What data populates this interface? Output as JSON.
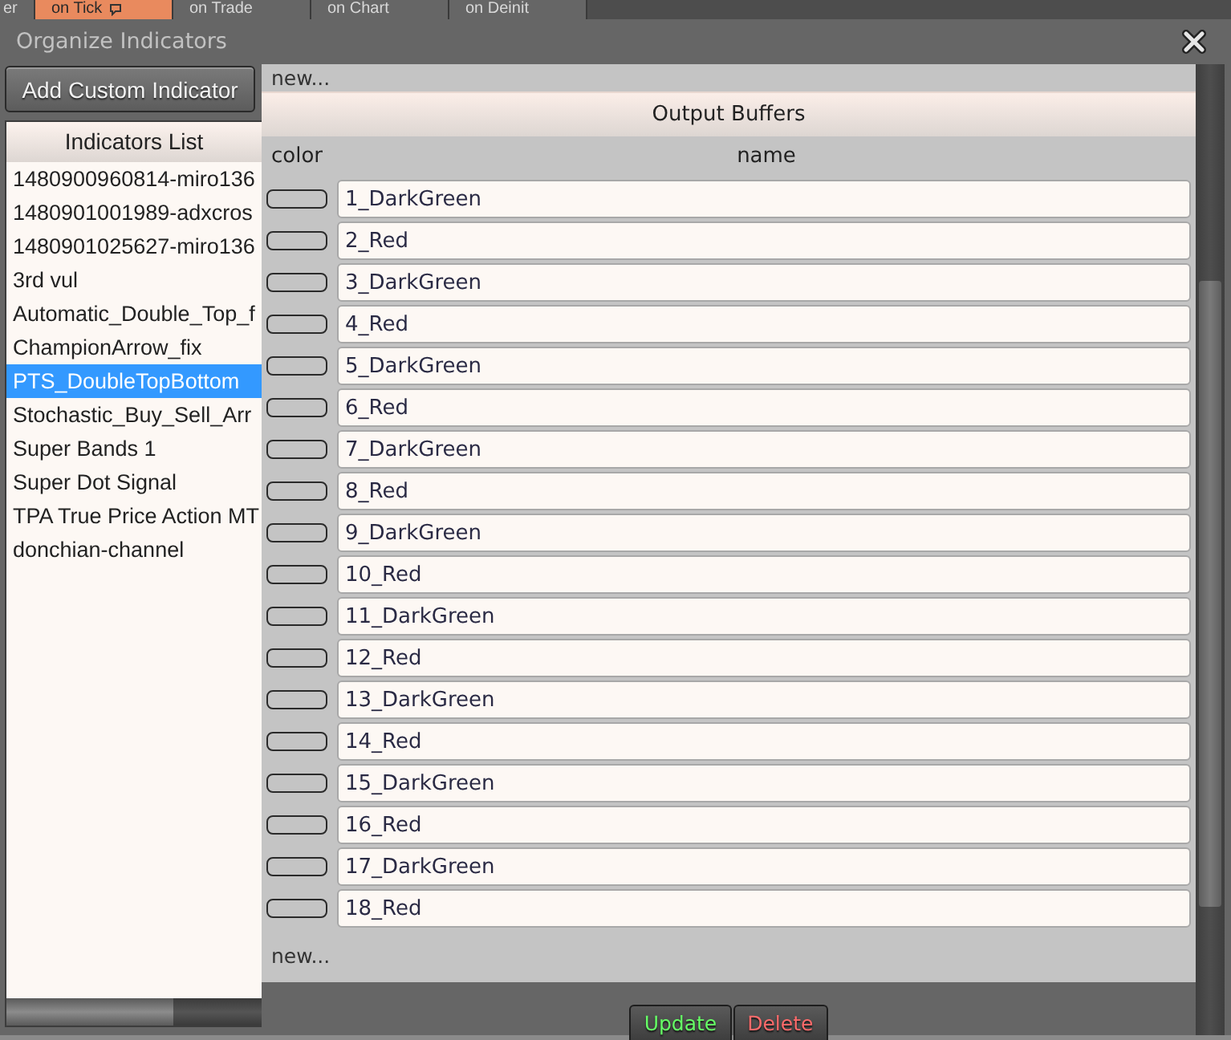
{
  "background_tabs": [
    {
      "label": "er",
      "selected": false,
      "marked": false
    },
    {
      "label": "on Tick",
      "selected": true,
      "marked": true
    },
    {
      "label": "on Trade",
      "selected": false,
      "marked": false
    },
    {
      "label": "on Chart",
      "selected": false,
      "marked": false
    },
    {
      "label": "on Deinit",
      "selected": false,
      "marked": false
    }
  ],
  "window": {
    "title": "Organize Indicators"
  },
  "add_button": {
    "label": "Add Custom Indicator"
  },
  "indicators_list": {
    "title": "Indicators List",
    "items": [
      {
        "label": "1480900960814-miro136",
        "selected": false
      },
      {
        "label": "1480901001989-adxcros",
        "selected": false
      },
      {
        "label": "1480901025627-miro136",
        "selected": false
      },
      {
        "label": "3rd vul",
        "selected": false
      },
      {
        "label": "Automatic_Double_Top_f",
        "selected": false
      },
      {
        "label": "ChampionArrow_fix",
        "selected": false
      },
      {
        "label": "PTS_DoubleTopBottom",
        "selected": true
      },
      {
        "label": "Stochastic_Buy_Sell_Arr",
        "selected": false
      },
      {
        "label": "Super Bands 1",
        "selected": false
      },
      {
        "label": "Super Dot Signal",
        "selected": false
      },
      {
        "label": "TPA True Price Action MT",
        "selected": false
      },
      {
        "label": "donchian-channel",
        "selected": false
      }
    ]
  },
  "output_buffers": {
    "top_link": "new...",
    "title": "Output Buffers",
    "columns": [
      "color",
      "name"
    ],
    "rows": [
      {
        "name": "1_DarkGreen"
      },
      {
        "name": "2_Red"
      },
      {
        "name": "3_DarkGreen"
      },
      {
        "name": "4_Red"
      },
      {
        "name": "5_DarkGreen"
      },
      {
        "name": "6_Red"
      },
      {
        "name": "7_DarkGreen"
      },
      {
        "name": "8_Red"
      },
      {
        "name": "9_DarkGreen"
      },
      {
        "name": "10_Red"
      },
      {
        "name": "11_DarkGreen"
      },
      {
        "name": "12_Red"
      },
      {
        "name": "13_DarkGreen"
      },
      {
        "name": "14_Red"
      },
      {
        "name": "15_DarkGreen"
      },
      {
        "name": "16_Red"
      },
      {
        "name": "17_DarkGreen"
      },
      {
        "name": "18_Red"
      }
    ],
    "new_link": "new..."
  },
  "buttons": [
    {
      "label": "Update",
      "kind": "update"
    },
    {
      "label": "Delete",
      "kind": "delete"
    }
  ]
}
